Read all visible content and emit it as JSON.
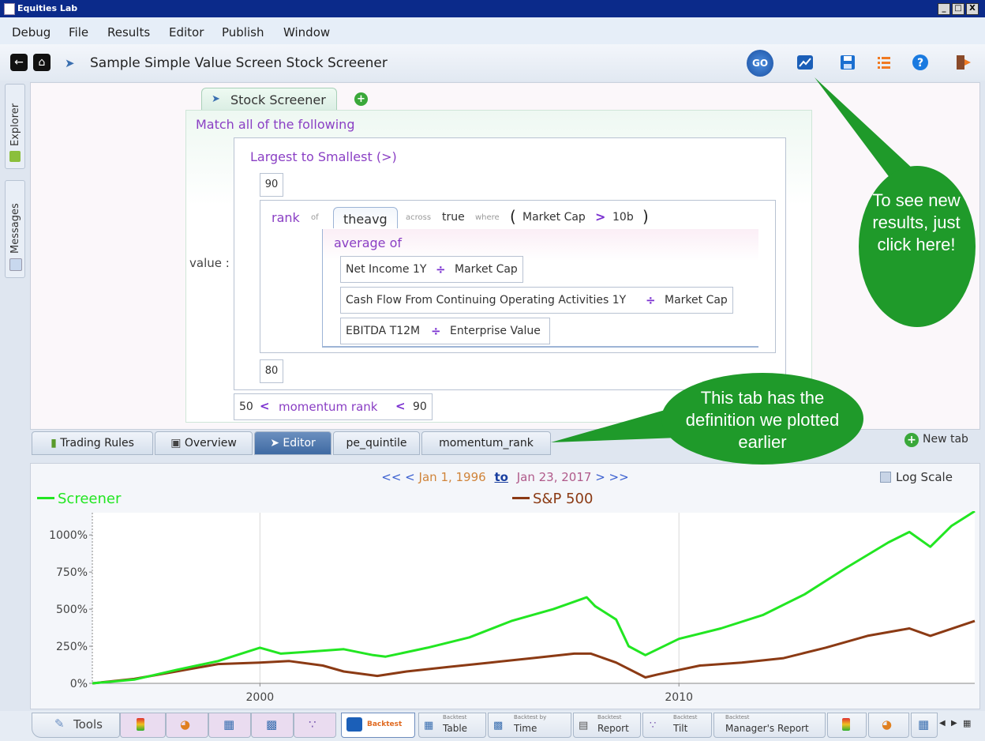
{
  "window": {
    "title": "Equities Lab",
    "buttons": [
      "_",
      "□",
      "X"
    ]
  },
  "menu": [
    "Debug",
    "File",
    "Results",
    "Editor",
    "Publish",
    "Window"
  ],
  "toolbar": {
    "doc_title": "Sample Simple Value Screen Stock Screener",
    "go_label": "GO"
  },
  "sidebar": {
    "explorer": "Explorer",
    "messages": "Messages"
  },
  "editor": {
    "tab_label": "Stock Screener",
    "match_label": "Match all of the following",
    "sort_label": "Largest to Smallest (>)",
    "upper_value": "90",
    "lower_value": "80",
    "value_label": "value :",
    "rank": "rank",
    "of": "of",
    "func": "theavg",
    "across": "across",
    "across_value": "true",
    "where": "where",
    "open_paren": "(",
    "cond_field": "Market Cap",
    "cond_op": ">",
    "cond_value": "10b",
    "close_paren": ")",
    "average_of": "average of",
    "div": "÷",
    "ratios": [
      {
        "num": "Net Income 1Y",
        "den": "Market Cap"
      },
      {
        "num": "Cash Flow From Continuing Operating Activities 1Y",
        "den": "Market Cap"
      },
      {
        "num": "EBITDA T12M",
        "den": "Enterprise Value"
      }
    ],
    "momentum": {
      "low": "50",
      "lt1": "<",
      "field": "momentum rank",
      "lt2": "<",
      "high": "90"
    }
  },
  "bottom_tabs": [
    "Trading Rules",
    "Overview",
    "Editor",
    "pe_quintile",
    "momentum_rank"
  ],
  "new_tab": "New tab",
  "chart_header": {
    "nav_left": "<< <",
    "start": "Jan 1, 1996",
    "to": "to",
    "end": "Jan 23, 2017",
    "nav_right": "> >>",
    "log_scale": "Log Scale"
  },
  "chart_data": {
    "type": "line",
    "xlim": [
      1996.0,
      2017.06
    ],
    "ylim": [
      0,
      1150
    ],
    "yticks": [
      0,
      250,
      500,
      750,
      1000
    ],
    "yticklabels": [
      "0%",
      "250%",
      "500%",
      "750%",
      "1000%"
    ],
    "xticks": [
      2000,
      2010
    ],
    "xticklabels": [
      "2000",
      "2010"
    ],
    "grid": true,
    "legend": "top",
    "series": [
      {
        "name": "Screener",
        "color": "#22e622",
        "x": [
          1996.0,
          1997.0,
          1998.0,
          1999.0,
          2000.0,
          2000.5,
          2001.0,
          2002.0,
          2002.7,
          2003.0,
          2004.0,
          2005.0,
          2006.0,
          2007.0,
          2007.8,
          2008.0,
          2008.5,
          2008.8,
          2009.2,
          2010.0,
          2011.0,
          2012.0,
          2013.0,
          2014.0,
          2015.0,
          2015.5,
          2016.0,
          2016.5,
          2017.06
        ],
        "y": [
          0,
          25,
          90,
          150,
          240,
          200,
          210,
          230,
          190,
          180,
          240,
          310,
          420,
          500,
          580,
          520,
          430,
          250,
          190,
          300,
          370,
          460,
          600,
          780,
          950,
          1020,
          920,
          1060,
          1160
        ]
      },
      {
        "name": "S&P 500",
        "color": "#8b3a14",
        "x": [
          1996.0,
          1997.0,
          1998.0,
          1999.0,
          2000.0,
          2000.7,
          2001.5,
          2002.0,
          2002.8,
          2003.5,
          2004.5,
          2005.5,
          2006.5,
          2007.5,
          2007.9,
          2008.5,
          2009.2,
          2009.5,
          2010.5,
          2011.5,
          2012.5,
          2013.5,
          2014.5,
          2015.5,
          2016.0,
          2017.06
        ],
        "y": [
          0,
          30,
          80,
          130,
          140,
          150,
          120,
          80,
          50,
          80,
          110,
          140,
          170,
          200,
          200,
          140,
          40,
          60,
          120,
          140,
          170,
          240,
          320,
          370,
          320,
          420
        ]
      }
    ]
  },
  "callouts": {
    "go": "To see new results, just click here!",
    "tab": "This tab has the definition we plotted earlier"
  },
  "bottom_bar": [
    {
      "label": "Tools"
    },
    {
      "small": "Backtest",
      "label": "Table"
    },
    {
      "small": "Backtest by",
      "label": "Time"
    },
    {
      "small": "Backtest",
      "label": "Report"
    },
    {
      "small": "Backtest",
      "label": "Tilt"
    },
    {
      "small": "Backtest",
      "label": "Manager's Report"
    }
  ],
  "backtest_label": "Backtest"
}
